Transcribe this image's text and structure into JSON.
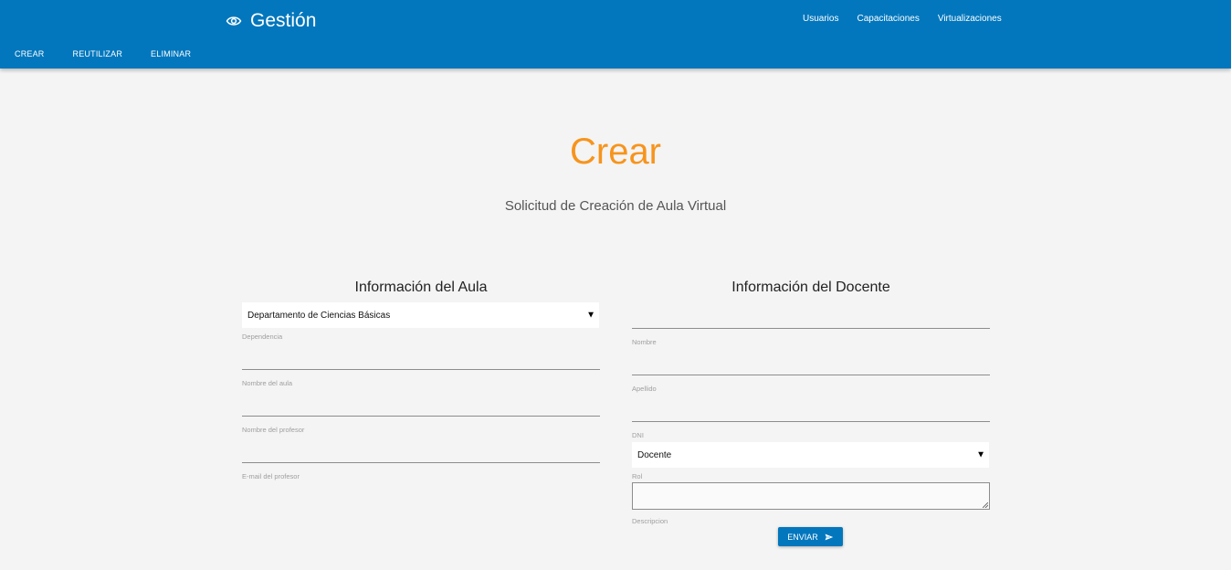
{
  "header": {
    "brand_title": "Gestión",
    "brand_icon": "eye-icon",
    "nav": [
      "Usuarios",
      "Capacitaciones",
      "Virtualizaciones"
    ],
    "actions": [
      "CREAR",
      "REUTILIZAR",
      "ELIMINAR"
    ],
    "colors": {
      "bar": "#0277bd",
      "text": "#ffffff"
    }
  },
  "main": {
    "title": "Crear",
    "subtitle": "Solicitud de Creación de Aula Virtual",
    "title_color": "#f7941d"
  },
  "aula": {
    "heading": "Información del Aula",
    "dependencia_value": "Departamento de Ciencias Básicas",
    "dependencia_label": "Dependencia",
    "nombre_aula_label": "Nombre del aula",
    "nombre_profesor_label": "Nombre del profesor",
    "email_profesor_label": "E-mail del profesor"
  },
  "docente": {
    "heading": "Información del Docente",
    "nombre_label": "Nombre",
    "apellido_label": "Apellido",
    "dni_label": "DNI",
    "rol_value": "Docente",
    "rol_label": "Rol",
    "descripcion_label": "Descripcion"
  },
  "submit": {
    "label": "ENVIAR",
    "icon": "send-icon"
  }
}
